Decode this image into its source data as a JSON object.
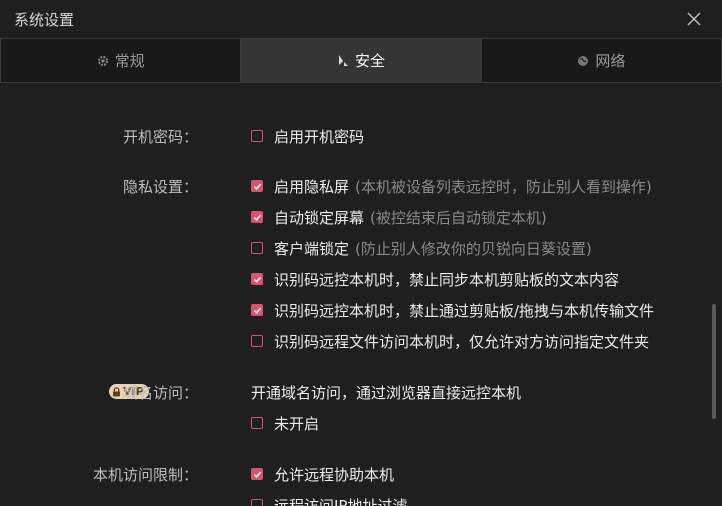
{
  "window": {
    "title": "系统设置"
  },
  "tabs": [
    {
      "label": "常规",
      "icon": "gear-icon",
      "active": false
    },
    {
      "label": "安全",
      "icon": "shield-icon",
      "active": true
    },
    {
      "label": "网络",
      "icon": "globe-icon",
      "active": false
    }
  ],
  "sections": {
    "boot_password": {
      "label": "开机密码：",
      "options": [
        {
          "text": "启用开机密码",
          "note": "",
          "checked": false
        }
      ]
    },
    "privacy": {
      "label": "隐私设置：",
      "options": [
        {
          "text": "启用隐私屏",
          "note": "(本机被设备列表远控时，防止别人看到操作)",
          "checked": true
        },
        {
          "text": "自动锁定屏幕",
          "note": "(被控结束后自动锁定本机)",
          "checked": true
        },
        {
          "text": "客户端锁定",
          "note": "(防止别人修改你的贝锐向日葵设置)",
          "checked": false
        },
        {
          "text": "识别码远控本机时，禁止同步本机剪贴板的文本内容",
          "note": "",
          "checked": true
        },
        {
          "text": "识别码远控本机时，禁止通过剪贴板/拖拽与本机传输文件",
          "note": "",
          "checked": true
        },
        {
          "text": "识别码远程文件访问本机时，仅允许对方访问指定文件夹",
          "note": "",
          "checked": false
        }
      ]
    },
    "domain_access": {
      "badge": "VIP",
      "label": "域名访问：",
      "description": "开通域名访问，通过浏览器直接远控本机",
      "options": [
        {
          "text": "未开启",
          "note": "",
          "checked": false
        }
      ]
    },
    "access_limit": {
      "label": "本机访问限制：",
      "options": [
        {
          "text": "允许远程协助本机",
          "note": "",
          "checked": true
        },
        {
          "text": "远程访问IP地址过滤",
          "note": "",
          "checked": false
        }
      ]
    }
  },
  "colors": {
    "accent": "#e0506b",
    "background": "#1f1f1f",
    "active_tab": "#353535"
  }
}
